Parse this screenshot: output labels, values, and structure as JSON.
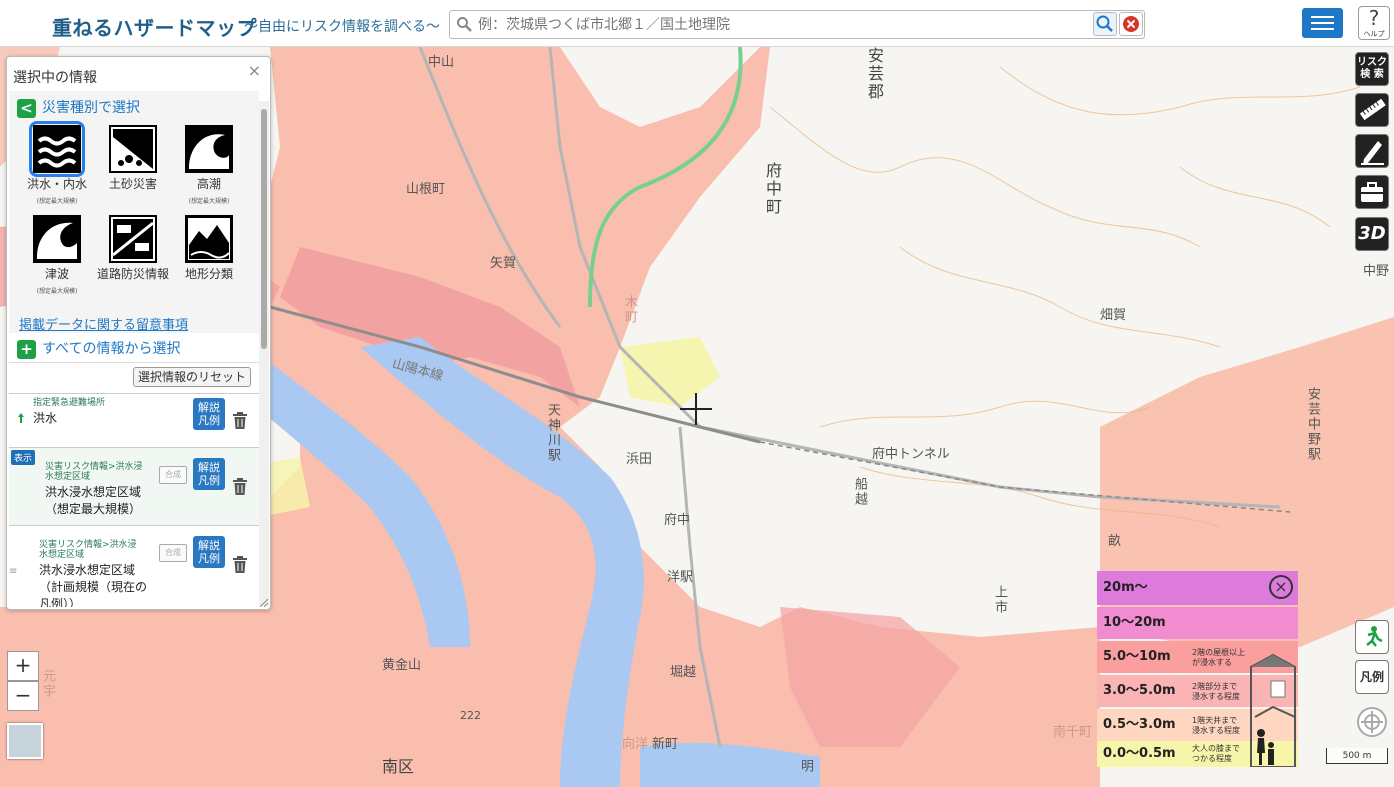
{
  "header": {
    "title": "重ねるハザードマップ",
    "subtitle": "〜自由にリスク情報を調べる〜",
    "search_placeholder": "例：茨城県つくば市北郷１／国土地理院",
    "help_symbol": "?",
    "help_label": "ヘルプ"
  },
  "panel": {
    "title": "選択中の情報",
    "close": "×",
    "by_type_heading": "災害種別で選択",
    "by_type_icon": "<",
    "hazards": [
      {
        "label": "洪水・内水",
        "sub": "(想定最大規模)",
        "selected": true,
        "icon": "flood-icon"
      },
      {
        "label": "土砂災害",
        "sub": "",
        "selected": false,
        "icon": "landslide-icon"
      },
      {
        "label": "高潮",
        "sub": "(想定最大規模)",
        "selected": false,
        "icon": "storm-surge-icon"
      },
      {
        "label": "津波",
        "sub": "(想定最大規模)",
        "selected": false,
        "icon": "tsunami-icon"
      },
      {
        "label": "道路防災情報",
        "sub": "",
        "selected": false,
        "icon": "road-disaster-icon"
      },
      {
        "label": "地形分類",
        "sub": "",
        "selected": false,
        "icon": "terrain-icon"
      }
    ],
    "notes_link": "掲載データに関する留意事項",
    "all_info_heading": "すべての情報から選択",
    "all_info_icon": "+",
    "reset_label": "選択情報のリセット",
    "items": [
      {
        "path": "指定緊急避難場所",
        "name": "洪水",
        "legend": "解説\n凡例"
      },
      {
        "show_badge": "表示",
        "path": "災害リスク情報>洪水浸\n水想定区域",
        "name": "洪水浸水想定区域\n（想定最大規模）",
        "combine": "合成",
        "legend": "解説\n凡例"
      },
      {
        "path": "災害リスク情報>洪水浸\n水想定区域",
        "name": "洪水浸水想定区域\n（計画規模（現在の\n凡例））",
        "combine": "合成",
        "legend": "解説\n凡例"
      }
    ]
  },
  "tools": {
    "risk_search": "リスク\n検 索",
    "three_d": "3D",
    "legend_btn": "凡例"
  },
  "zoom": {
    "in": "+",
    "out": "−"
  },
  "map_labels": {
    "l1": "中山",
    "l2": "安芸郡",
    "l3": "山根町",
    "l4": "府中町",
    "l5": "矢賀",
    "l6": "木町",
    "l7": "中野",
    "l8": "畑賀",
    "l9": "山陽本線",
    "l10": "天神川駅",
    "l11": "浜田",
    "l12": "府中トンネル",
    "l13": "船越",
    "l14": "安芸中野駅",
    "l15": "府中",
    "l16": "洋駅",
    "l17": "畝",
    "l18": "上市",
    "l19": "黄金山",
    "l20": "堀越",
    "l21": "222",
    "l22": "南区",
    "l23": "新町",
    "l24": "向洋",
    "l25": "明",
    "l26": "南千町",
    "l27": "元宇"
  },
  "legend": {
    "close": "×",
    "rows": [
      {
        "value": "20m〜",
        "desc": "",
        "color": "#dd7bdd"
      },
      {
        "value": "10〜20m",
        "desc": "",
        "color": "#f08ccf"
      },
      {
        "value": "5.0〜10m",
        "desc": "2階の屋根以上\nが浸水する",
        "color": "#fa9e9e"
      },
      {
        "value": "3.0〜5.0m",
        "desc": "2階部分まで\n浸水する程度",
        "color": "#fbb4b4"
      },
      {
        "value": "0.5〜3.0m",
        "desc": "1階天井まで\n浸水する程度",
        "color": "#ffd6bf"
      },
      {
        "value": "0.0〜0.5m",
        "desc": "大人の膝まで\nつかる程度",
        "color": "#f6f5a9"
      }
    ]
  },
  "scale": "500 m",
  "colors": {
    "flood_pink": "#f9b8a6",
    "flood_dark": "#f3a2a2",
    "river": "#a9c8f2",
    "accent": "#1e78c6"
  }
}
